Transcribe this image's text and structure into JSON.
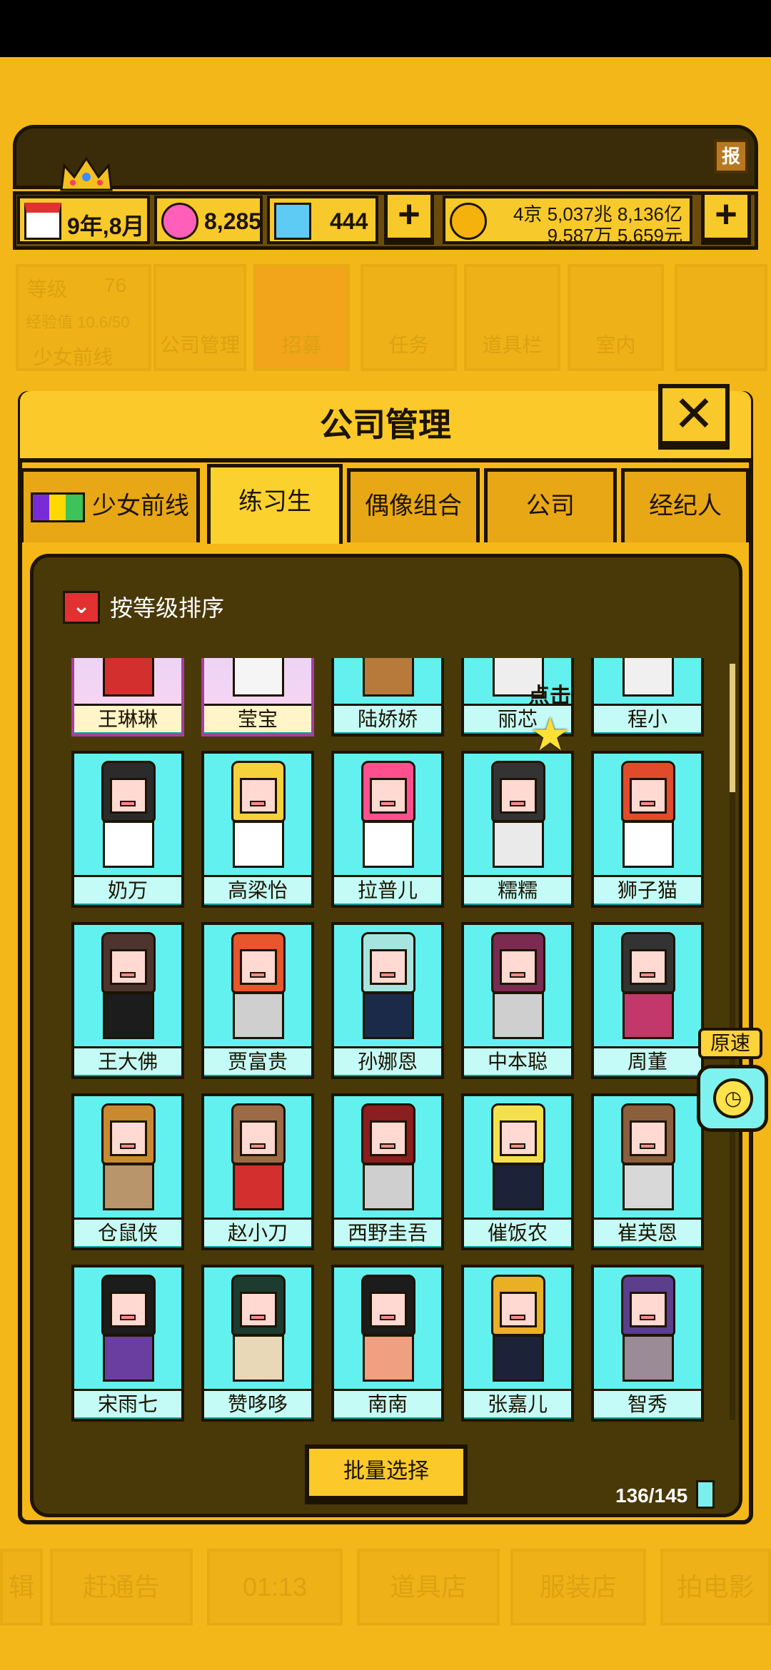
{
  "hud": {
    "date": "9年,8月",
    "gems": "8,285",
    "diamonds": "444",
    "money_line1": "4京 5,037兆 8,136亿",
    "money_line2": "9,587万 5,659元",
    "report_label": "报"
  },
  "ghost_menu": {
    "level_label": "等级",
    "level_value": "76",
    "exp_label": "经验值 10.6/50",
    "frontline_label": "少女前线",
    "items": [
      "公司管理",
      "招募",
      "任务",
      "道具栏",
      "室内"
    ]
  },
  "panel": {
    "title": "公司管理",
    "close_label": "✕",
    "tabs": [
      "少女前线",
      "练习生",
      "偶像组合",
      "公司",
      "经纪人"
    ],
    "active_tab": "练习生",
    "sort_label": "按等级排序",
    "tip": "点击",
    "batch_label": "批量选择",
    "count": "136/145"
  },
  "speed": {
    "label": "原速"
  },
  "trainees": [
    {
      "name": "王琳琳",
      "hair": "#b71c1c",
      "body": "#d32f2f",
      "special": true
    },
    {
      "name": "莹宝",
      "hair": "#ffffff",
      "body": "#f5f5f5",
      "special": true
    },
    {
      "name": "陆娇娇",
      "hair": "#c08040",
      "body": "#b87a3a",
      "special": false
    },
    {
      "name": "丽芯",
      "hair": "#ffffff",
      "body": "#eeeeee",
      "special": false
    },
    {
      "name": "程小",
      "hair": "#ffffff",
      "body": "#f0f0f0",
      "special": false
    },
    {
      "name": "奶万",
      "hair": "#2b2b2b",
      "body": "#ffffff",
      "special": false
    },
    {
      "name": "高梁怡",
      "hair": "#f5d23b",
      "body": "#ffffff",
      "special": false
    },
    {
      "name": "拉普儿",
      "hair": "#ff4f8e",
      "body": "#ffffff",
      "special": false
    },
    {
      "name": "糯糯",
      "hair": "#333333",
      "body": "#eaeaea",
      "special": false
    },
    {
      "name": "狮子猫",
      "hair": "#e14b2c",
      "body": "#ffffff",
      "special": false
    },
    {
      "name": "王大佛",
      "hair": "#4e342e",
      "body": "#1c1c1c",
      "special": false
    },
    {
      "name": "贾富贵",
      "hair": "#e8562b",
      "body": "#cfcfcf",
      "special": false
    },
    {
      "name": "孙娜恩",
      "hair": "#a6e5df",
      "body": "#1c2a4a",
      "special": false
    },
    {
      "name": "中本聪",
      "hair": "#7b2b52",
      "body": "#cfcfcf",
      "special": false
    },
    {
      "name": "周董",
      "hair": "#333333",
      "body": "#c2386b",
      "special": false
    },
    {
      "name": "仓鼠侠",
      "hair": "#c8892f",
      "body": "#b8956b",
      "special": false
    },
    {
      "name": "赵小刀",
      "hair": "#9c6b45",
      "body": "#d32f2f",
      "special": false
    },
    {
      "name": "西野圭吾",
      "hair": "#8b1e1e",
      "body": "#cfcfcf",
      "special": false
    },
    {
      "name": "催饭农",
      "hair": "#f4e04d",
      "body": "#1c2238",
      "special": false
    },
    {
      "name": "崔英恩",
      "hair": "#8b5e3c",
      "body": "#d8d8d8",
      "special": false
    },
    {
      "name": "宋雨七",
      "hair": "#1c1c1c",
      "body": "#6a3ea1",
      "special": false
    },
    {
      "name": "赞哆哆",
      "hair": "#1d3b2e",
      "body": "#e8d8b8",
      "special": false
    },
    {
      "name": "南南",
      "hair": "#1c1c1c",
      "body": "#f0a080",
      "special": false
    },
    {
      "name": "张嘉儿",
      "hair": "#e8b024",
      "body": "#1c2238",
      "special": false
    },
    {
      "name": "智秀",
      "hair": "#5b3e8c",
      "body": "#9b8b96",
      "special": false
    }
  ],
  "bottom_menu": [
    "辑",
    "赶通告",
    "01:13",
    "道具店",
    "服装店",
    "拍电影"
  ],
  "colors": {
    "background": "#f4b71a",
    "panel_dark": "#4a3908",
    "card_cyan": "#63f1ef",
    "outline": "#1c1400"
  }
}
